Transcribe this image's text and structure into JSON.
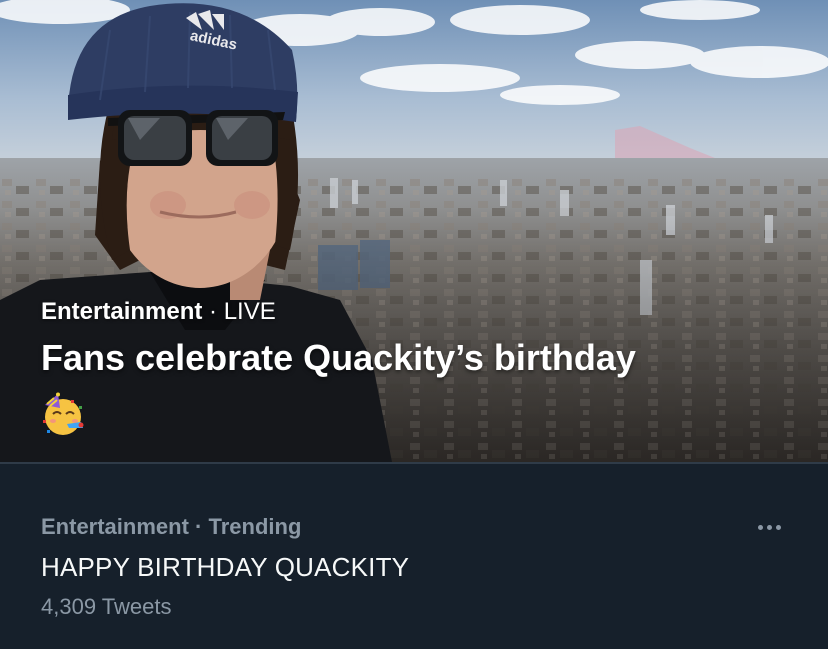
{
  "hero": {
    "category": "Entertainment",
    "separator": "·",
    "status": "LIVE",
    "headline": "Fans celebrate Quackity’s birthday",
    "emoji_icon": "partying-face-icon",
    "hat_text": "adidas"
  },
  "trend": {
    "category": "Entertainment",
    "separator": "·",
    "status": "Trending",
    "title": "HAPPY BIRTHDAY QUACKITY",
    "count": "4,309 Tweets",
    "more_icon": "more-horizontal-icon"
  },
  "colors": {
    "background": "#16202b",
    "divider": "#2f3b48",
    "secondary_text": "#8b98a5",
    "primary_text": "#f7f9f9",
    "hero_text": "#ffffff"
  }
}
